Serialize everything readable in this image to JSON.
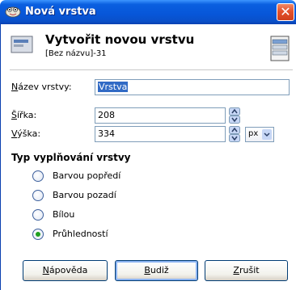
{
  "window": {
    "title": "Nová vrstva",
    "close_label": "✕"
  },
  "header": {
    "title": "Vytvořit novou vrstvu",
    "subtitle": "[Bez názvu]-31"
  },
  "form": {
    "name_label_first": "N",
    "name_label_rest": "ázev vrstvy:",
    "name_value": "Vrstva",
    "width_label_first": "Š",
    "width_label_rest": "ířka:",
    "width_value": "208",
    "height_label_first": "V",
    "height_label_rest": "ýška:",
    "height_value": "334",
    "unit_value": "px"
  },
  "fill": {
    "section_title": "Typ vyplňování vrstvy",
    "options": [
      {
        "label": "Barvou popředí",
        "checked": false
      },
      {
        "label": "Barvou pozadí",
        "checked": false
      },
      {
        "label": "Bílou",
        "checked": false
      },
      {
        "label": "Průhledností",
        "checked": true
      }
    ]
  },
  "buttons": {
    "help_first": "N",
    "help_rest": "ápověda",
    "ok_first": "B",
    "ok_rest": "udiž",
    "cancel_first": "Z",
    "cancel_rest": "rušit"
  },
  "colors": {
    "titlebar": "#0756d8",
    "selection": "#316ac5",
    "radio_checked": "#20a020"
  },
  "icons": {
    "app": "gimp-icon",
    "header": "layer-icon",
    "header_right": "layer-stack-icon"
  }
}
